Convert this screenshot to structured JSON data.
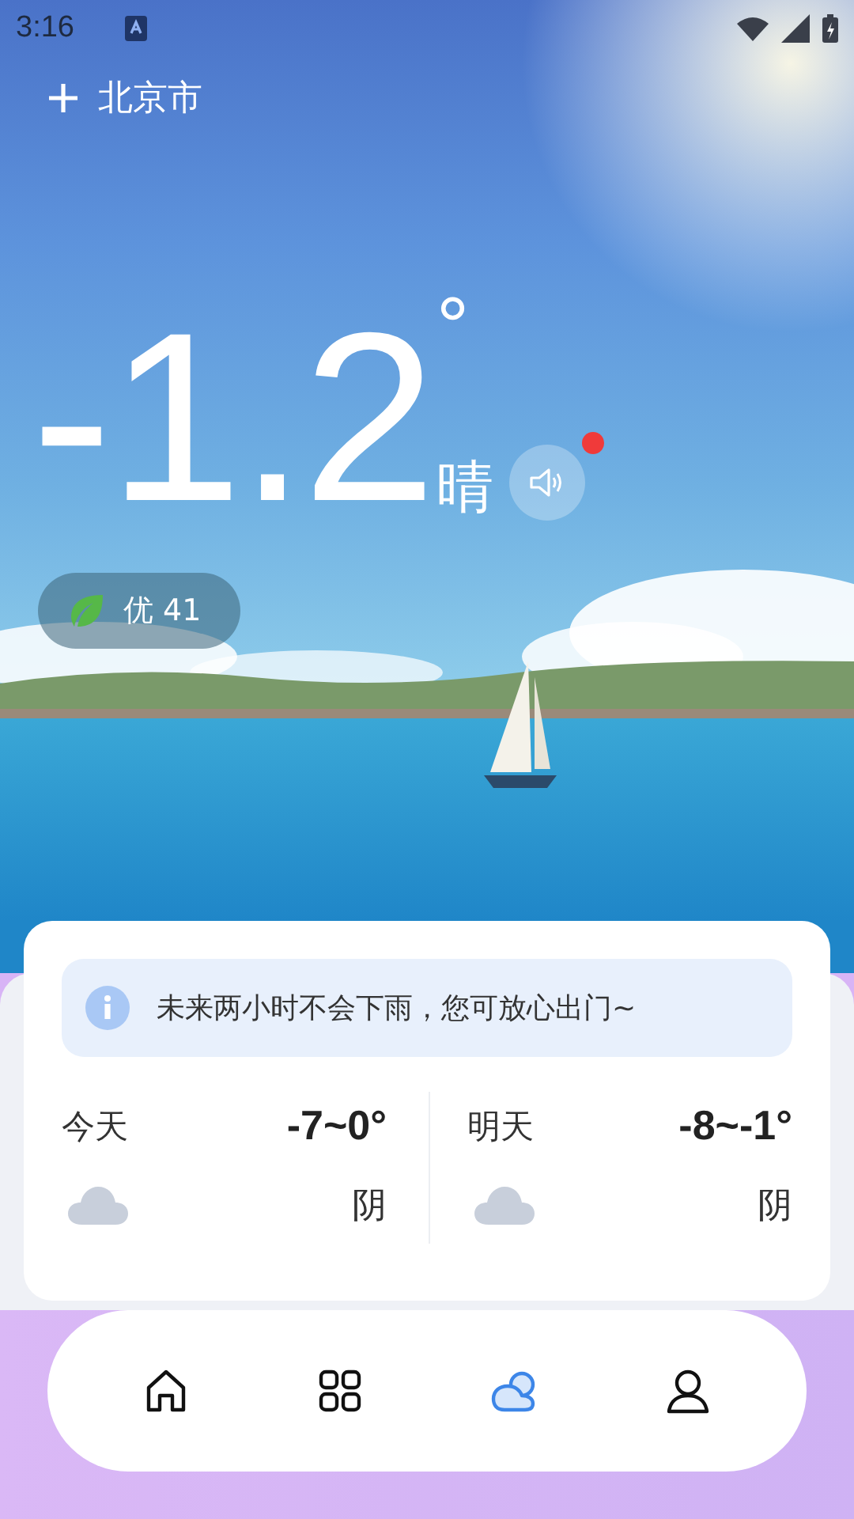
{
  "status_bar": {
    "time": "3:16"
  },
  "header": {
    "city": "北京市"
  },
  "current": {
    "temperature": "-1.2",
    "unit": "°",
    "condition": "晴",
    "speaker": {
      "unread": true
    }
  },
  "air_quality": {
    "label": "优 41"
  },
  "notice": {
    "text": "未来两小时不会下雨，您可放心出门~"
  },
  "forecast": [
    {
      "day": "今天",
      "range": "-7~0°",
      "condition": "阴"
    },
    {
      "day": "明天",
      "range": "-8~-1°",
      "condition": "阴"
    }
  ],
  "nav": [
    {
      "kind": "home",
      "selected": false
    },
    {
      "kind": "grid",
      "selected": false
    },
    {
      "kind": "weather",
      "selected": true
    },
    {
      "kind": "profile",
      "selected": false
    }
  ]
}
